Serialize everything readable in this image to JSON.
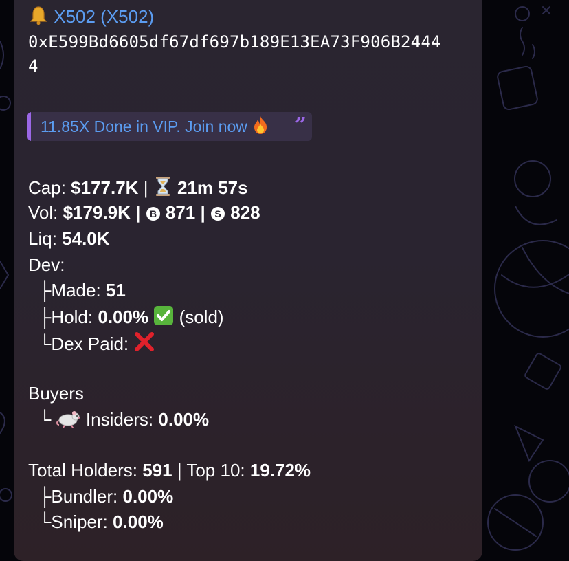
{
  "token": {
    "bell_icon": "bell-icon",
    "name": "X502 (X502)",
    "address_line1": "0xE599Bd6605df67df697b189E13EA73F906B2444",
    "address_line2": "4"
  },
  "promo": {
    "text": "11.85X Done in VIP. Join now",
    "fire_icon": "fire-icon",
    "quote_icon": "quote-icon"
  },
  "stats": {
    "cap_label": "Cap:",
    "cap_value": "$177.7K",
    "sep1": "|",
    "age_value": "21m 57s",
    "vol_label": "Vol:",
    "vol_value": "$179.9K |",
    "buys_value": "871 |",
    "sells_value": "828",
    "liq_label": "Liq:",
    "liq_value": "54.0K"
  },
  "dev": {
    "label": "Dev:",
    "made_prefix": "├Made:",
    "made_value": "51",
    "hold_prefix": "├Hold:",
    "hold_value": "0.00%",
    "hold_suffix": "(sold)",
    "dex_prefix": "└Dex Paid:"
  },
  "buyers": {
    "label": "Buyers",
    "insiders_prefix": "└",
    "insiders_label": "Insiders:",
    "insiders_value": "0.00%"
  },
  "holders": {
    "total_label": "Total Holders:",
    "total_value": "591",
    "top10_label": "| Top 10:",
    "top10_value": "19.72%",
    "bundler_prefix": "├Bundler:",
    "bundler_value": "0.00%",
    "sniper_prefix": "└Sniper:",
    "sniper_value": "0.00%"
  },
  "colors": {
    "link": "#5b9cf0",
    "quote_accent": "#9b67e6",
    "bubble": "#2a2530"
  }
}
